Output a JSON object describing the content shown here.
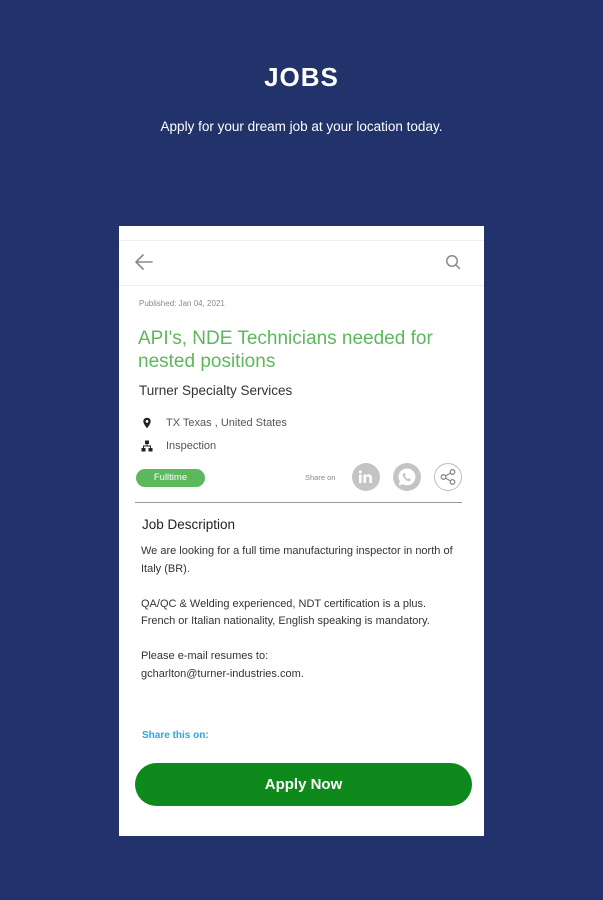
{
  "promo": {
    "title": "JOBS",
    "subtitle": "Apply for your dream job at your location today."
  },
  "job": {
    "published": "Published: Jan 04, 2021",
    "title": "API's, NDE Technicians needed for nested positions",
    "company": "Turner Specialty Services",
    "location": "TX Texas , United States",
    "category": "Inspection",
    "employment_type": "Fulltime"
  },
  "share": {
    "label": "Share on"
  },
  "description": {
    "heading": "Job Description",
    "paragraphs": [
      "We are looking for a full time manufacturing inspector in north of Italy (BR).",
      "QA/QC & Welding experienced, NDT certification is a plus.",
      "French or Italian nationality, English speaking is mandatory.",
      "Please e-mail resumes to:",
      "gcharlton@turner-industries.com."
    ],
    "share_this": "Share this on:"
  },
  "actions": {
    "apply_label": "Apply Now"
  },
  "colors": {
    "background": "#22336b",
    "title_green": "#5cb85c",
    "apply_green": "#0e8a1c",
    "link_blue": "#29a8e0"
  },
  "icons": {
    "back": "arrow-left-icon",
    "search": "search-icon",
    "location": "map-pin-icon",
    "category": "sitemap-icon",
    "linkedin": "linkedin-icon",
    "whatsapp": "whatsapp-icon",
    "share": "share-icon"
  }
}
